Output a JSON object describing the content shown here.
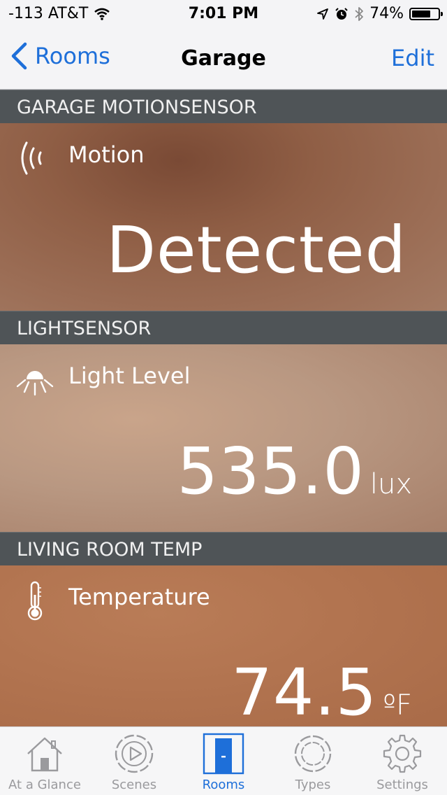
{
  "status_bar": {
    "carrier": "-113 AT&T",
    "time": "7:01 PM",
    "battery_percent": "74%",
    "battery_level": 0.74,
    "icons": [
      "wifi-icon",
      "location-arrow-icon",
      "alarm-icon",
      "bluetooth-icon",
      "battery-icon"
    ]
  },
  "nav": {
    "back_label": "Rooms",
    "title": "Garage",
    "edit_label": "Edit",
    "accent_color": "#1e6fd9"
  },
  "sections": [
    {
      "header": "GARAGE MOTIONSENSOR",
      "icon": "motion-waves-icon",
      "label": "Motion",
      "value": "Detected",
      "unit": ""
    },
    {
      "header": "LIGHTSENSOR",
      "icon": "light-bulb-icon",
      "label": "Light Level",
      "value": "535.0",
      "unit": "lux"
    },
    {
      "header": "LIVING ROOM TEMP",
      "icon": "thermometer-icon",
      "label": "Temperature",
      "value": "74.5",
      "unit": "ºF"
    }
  ],
  "tab_bar": {
    "active_index": 2,
    "tabs": [
      {
        "label": "At a Glance",
        "icon": "house-icon"
      },
      {
        "label": "Scenes",
        "icon": "play-circle-icon"
      },
      {
        "label": "Rooms",
        "icon": "door-icon"
      },
      {
        "label": "Types",
        "icon": "segmented-circle-icon"
      },
      {
        "label": "Settings",
        "icon": "gear-icon"
      }
    ]
  }
}
